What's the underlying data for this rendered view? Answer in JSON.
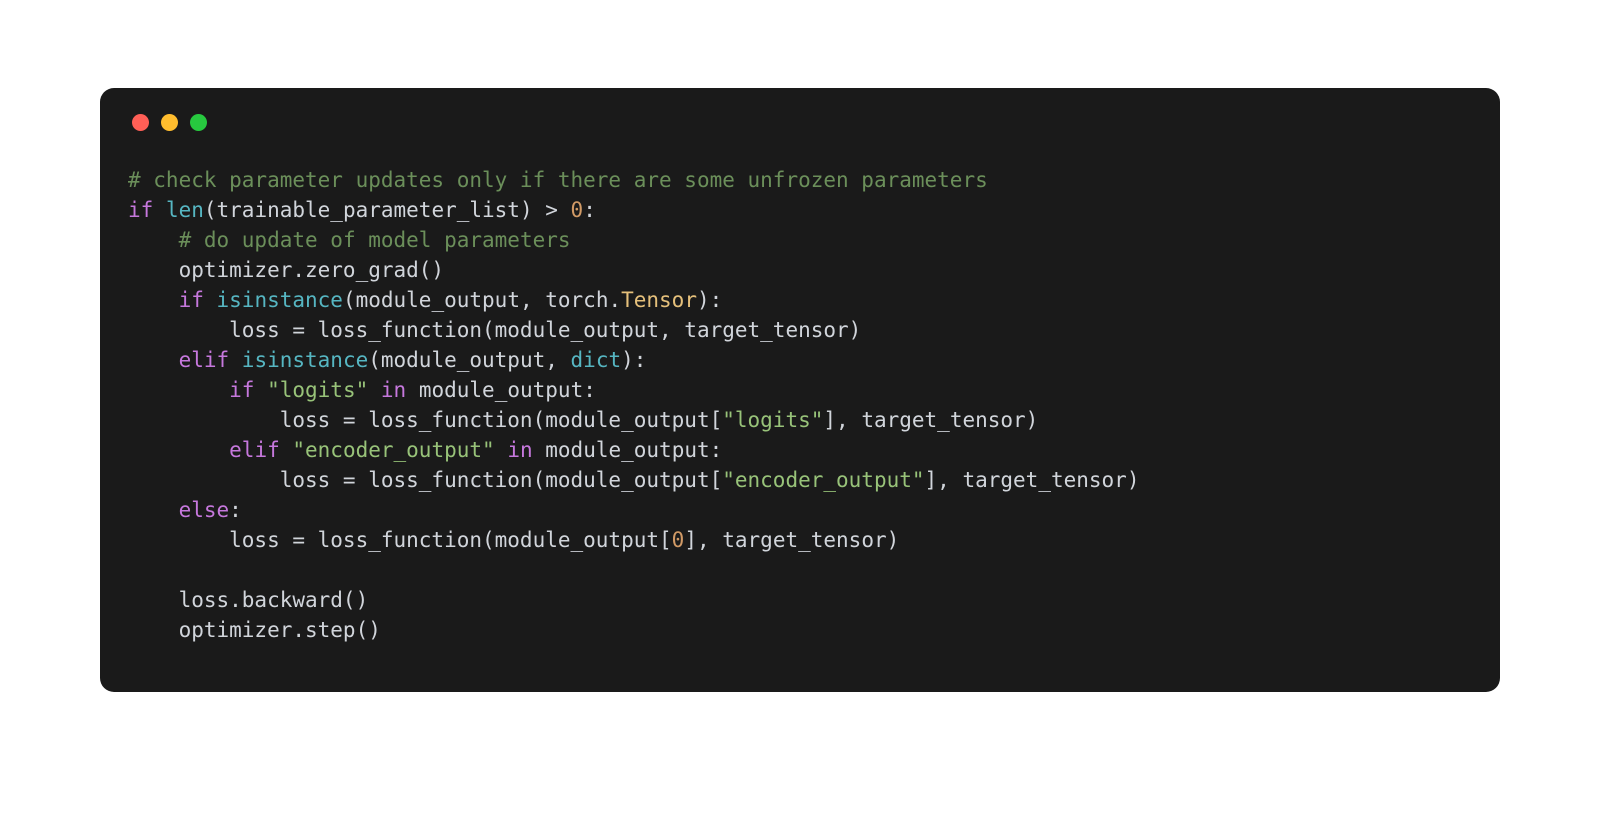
{
  "traffic_lights": {
    "red": "#ff5f56",
    "yellow": "#ffbd2e",
    "green": "#27c93f"
  },
  "code": {
    "lines": [
      [
        {
          "t": "# check parameter updates only if there are some unfrozen parameters",
          "c": "c-comment"
        }
      ],
      [
        {
          "t": "if ",
          "c": "c-kw"
        },
        {
          "t": "len",
          "c": "c-fn"
        },
        {
          "t": "(trainable_parameter_list) > ",
          "c": "c-ident"
        },
        {
          "t": "0",
          "c": "c-num"
        },
        {
          "t": ":",
          "c": "c-ident"
        }
      ],
      [
        {
          "t": "    ",
          "c": ""
        },
        {
          "t": "# do update of model parameters",
          "c": "c-comment"
        }
      ],
      [
        {
          "t": "    optimizer.zero_grad()",
          "c": "c-ident"
        }
      ],
      [
        {
          "t": "    ",
          "c": ""
        },
        {
          "t": "if ",
          "c": "c-kw"
        },
        {
          "t": "isinstance",
          "c": "c-fn"
        },
        {
          "t": "(module_output, torch.",
          "c": "c-ident"
        },
        {
          "t": "Tensor",
          "c": "c-member"
        },
        {
          "t": "):",
          "c": "c-ident"
        }
      ],
      [
        {
          "t": "        loss = loss_function(module_output, target_tensor)",
          "c": "c-ident"
        }
      ],
      [
        {
          "t": "    ",
          "c": ""
        },
        {
          "t": "elif ",
          "c": "c-kw"
        },
        {
          "t": "isinstance",
          "c": "c-fn"
        },
        {
          "t": "(module_output, ",
          "c": "c-ident"
        },
        {
          "t": "dict",
          "c": "c-fn"
        },
        {
          "t": "):",
          "c": "c-ident"
        }
      ],
      [
        {
          "t": "        ",
          "c": ""
        },
        {
          "t": "if ",
          "c": "c-kw"
        },
        {
          "t": "\"logits\"",
          "c": "c-str"
        },
        {
          "t": " ",
          "c": ""
        },
        {
          "t": "in",
          "c": "c-kw"
        },
        {
          "t": " module_output:",
          "c": "c-ident"
        }
      ],
      [
        {
          "t": "            loss = loss_function(module_output[",
          "c": "c-ident"
        },
        {
          "t": "\"logits\"",
          "c": "c-str"
        },
        {
          "t": "], target_tensor)",
          "c": "c-ident"
        }
      ],
      [
        {
          "t": "        ",
          "c": ""
        },
        {
          "t": "elif ",
          "c": "c-kw"
        },
        {
          "t": "\"encoder_output\"",
          "c": "c-str"
        },
        {
          "t": " ",
          "c": ""
        },
        {
          "t": "in",
          "c": "c-kw"
        },
        {
          "t": " module_output:",
          "c": "c-ident"
        }
      ],
      [
        {
          "t": "            loss = loss_function(module_output[",
          "c": "c-ident"
        },
        {
          "t": "\"encoder_output\"",
          "c": "c-str"
        },
        {
          "t": "], target_tensor)",
          "c": "c-ident"
        }
      ],
      [
        {
          "t": "    ",
          "c": ""
        },
        {
          "t": "else",
          "c": "c-kw"
        },
        {
          "t": ":",
          "c": "c-ident"
        }
      ],
      [
        {
          "t": "        loss = loss_function(module_output[",
          "c": "c-ident"
        },
        {
          "t": "0",
          "c": "c-num"
        },
        {
          "t": "], target_tensor)",
          "c": "c-ident"
        }
      ],
      [
        {
          "t": "",
          "c": ""
        }
      ],
      [
        {
          "t": "    loss.backward()",
          "c": "c-ident"
        }
      ],
      [
        {
          "t": "    optimizer.step()",
          "c": "c-ident"
        }
      ]
    ]
  }
}
